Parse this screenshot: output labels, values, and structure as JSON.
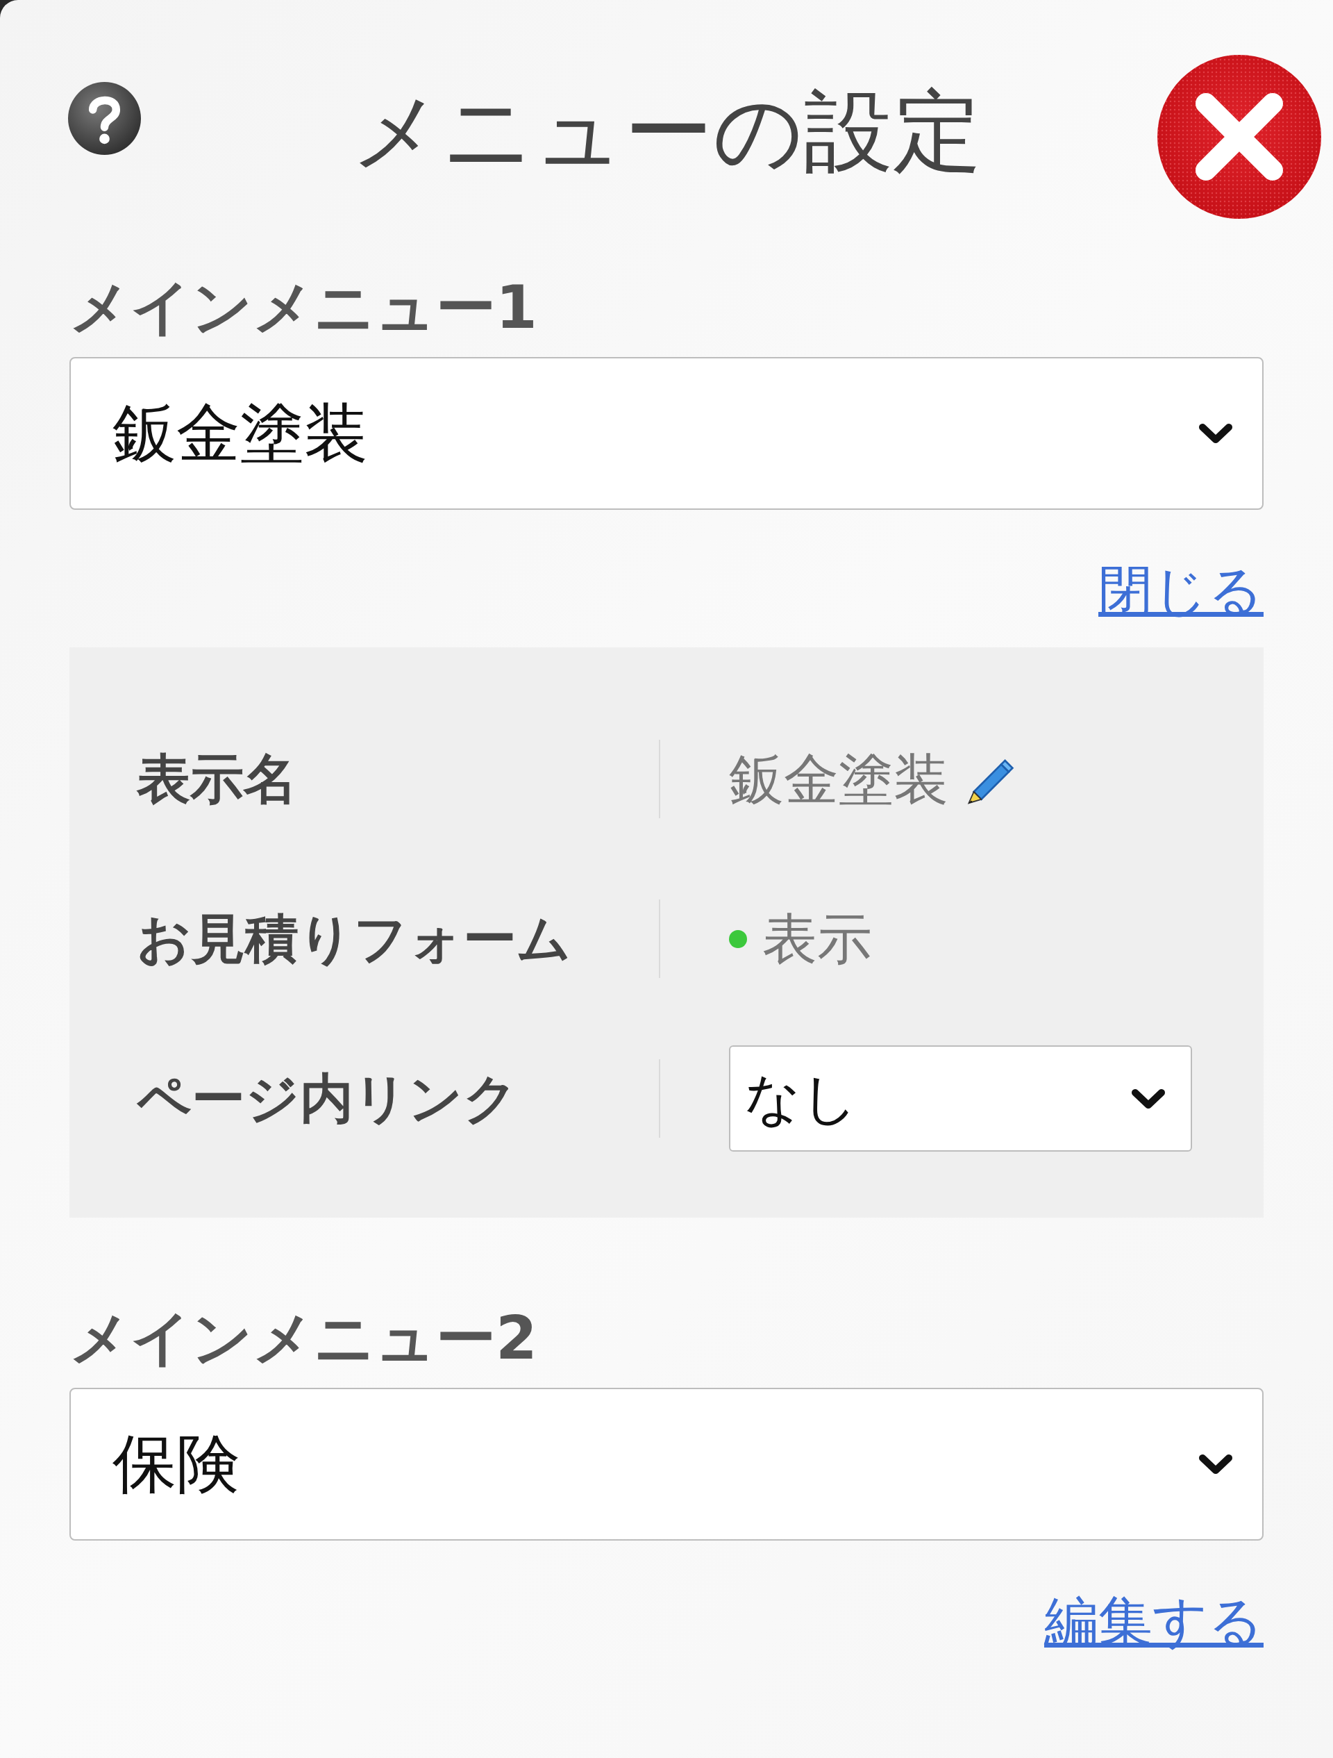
{
  "dialog": {
    "title": "メニューの設定"
  },
  "menus": [
    {
      "label": "メインメニュー1",
      "value": "鈑金塗装",
      "toggle_link": "閉じる",
      "details": [
        {
          "kind": "text",
          "label": "表示名",
          "value": "鈑金塗装",
          "editable": true
        },
        {
          "kind": "status",
          "label": "お見積りフォーム",
          "value": "表示",
          "on": true
        },
        {
          "kind": "select",
          "label": "ページ内リンク",
          "value": "なし"
        }
      ]
    },
    {
      "label": "メインメニュー2",
      "value": "保険",
      "toggle_link": "編集する"
    }
  ]
}
